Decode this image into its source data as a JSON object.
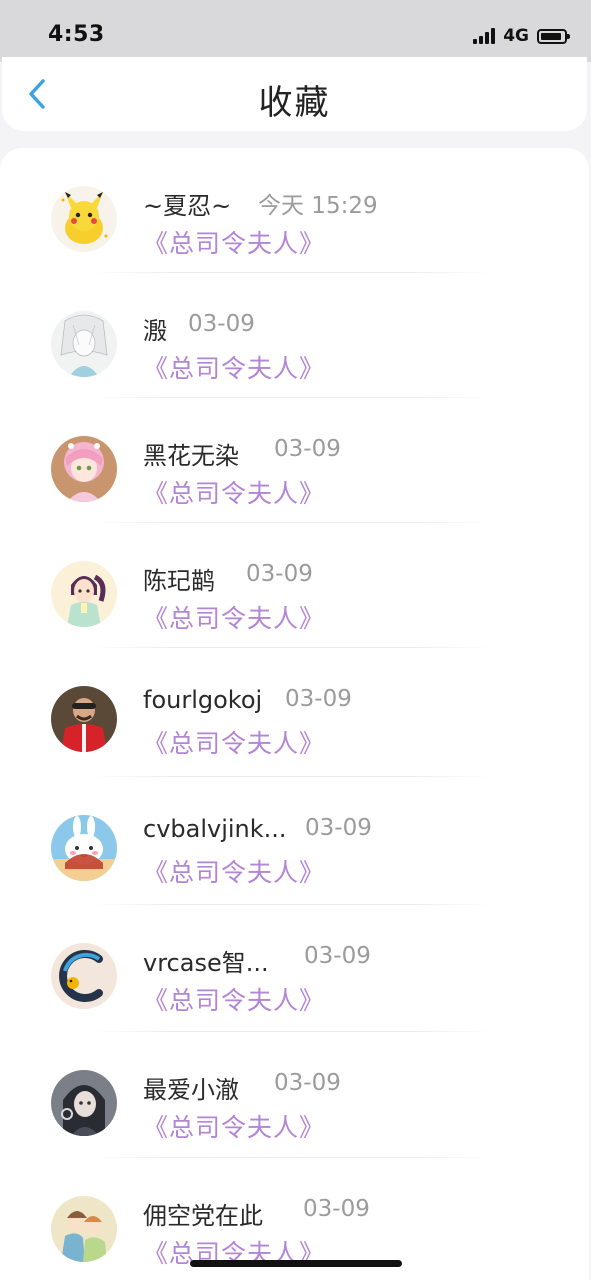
{
  "status_bar": {
    "time": "4:53",
    "network": "4G"
  },
  "header": {
    "title": "收藏",
    "back_icon": "chevron-left-icon",
    "accent_color": "#3aa3e3"
  },
  "list": {
    "book_color": "#b385d6",
    "items": [
      {
        "name": "~夏忍~",
        "time": "今天 15:29",
        "book": "《总司令夫人》",
        "avatar": "pikachu-avatar"
      },
      {
        "name": "溵",
        "time": "03-09",
        "book": "《总司令夫人》",
        "avatar": "sketch-character-avatar"
      },
      {
        "name": "黑花无染",
        "time": "03-09",
        "book": "《总司令夫人》",
        "avatar": "pink-hair-girl-avatar"
      },
      {
        "name": "陈玘鹋",
        "time": "03-09",
        "book": "《总司令夫人》",
        "avatar": "ponytail-girl-avatar"
      },
      {
        "name": "fourlgokoj",
        "time": "03-09",
        "book": "《总司令夫人》",
        "avatar": "red-jacket-man-avatar"
      },
      {
        "name": "cvbalvjink...",
        "time": "03-09",
        "book": "《总司令夫人》",
        "avatar": "bunny-cartoon-avatar"
      },
      {
        "name": "vrcase智...",
        "time": "03-09",
        "book": "《总司令夫人》",
        "avatar": "brand-logo-avatar"
      },
      {
        "name": "最爱小澈",
        "time": "03-09",
        "book": "《总司令夫人》",
        "avatar": "dark-hair-character-avatar"
      },
      {
        "name": "佣空党在此",
        "time": "03-09",
        "book": "《总司令夫人》",
        "avatar": "couple-illustration-avatar"
      }
    ]
  }
}
